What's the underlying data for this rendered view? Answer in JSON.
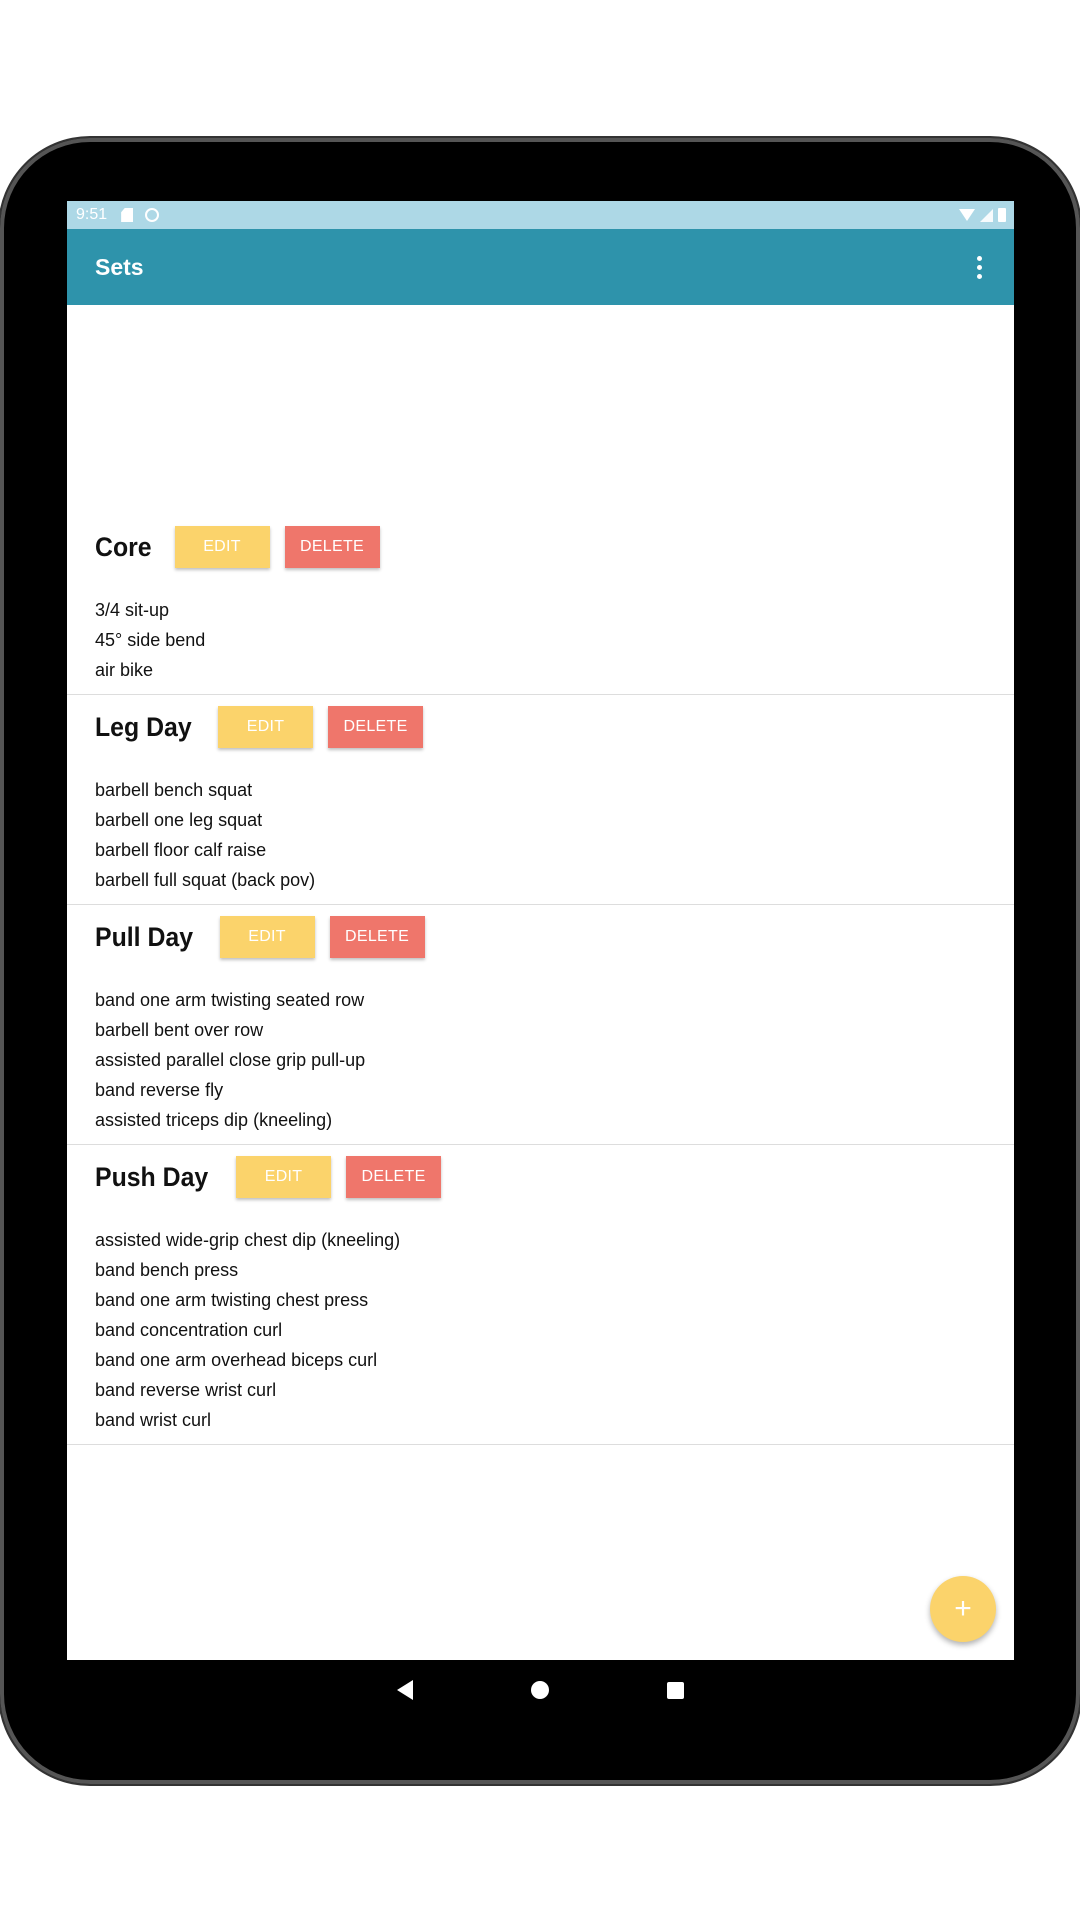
{
  "status_bar": {
    "time": "9:51"
  },
  "app_bar": {
    "title": "Sets"
  },
  "buttons": {
    "edit_label": "EDIT",
    "delete_label": "DELETE"
  },
  "sets": [
    {
      "name": "Core",
      "exercises": [
        "3/4 sit-up",
        "45° side bend",
        "air bike"
      ]
    },
    {
      "name": "Leg Day",
      "exercises": [
        "barbell bench squat",
        "barbell one leg squat",
        "barbell floor calf raise",
        "barbell full squat (back pov)"
      ]
    },
    {
      "name": "Pull Day",
      "exercises": [
        "band one arm twisting seated row",
        "barbell bent over row",
        "assisted parallel close grip pull-up",
        "band reverse fly",
        "assisted triceps dip (kneeling)"
      ]
    },
    {
      "name": "Push Day",
      "exercises": [
        "assisted wide-grip chest dip (kneeling)",
        "band bench press",
        "band one arm twisting chest press",
        "band concentration curl",
        "band one arm overhead biceps curl",
        "band reverse wrist curl",
        "band wrist curl"
      ]
    }
  ],
  "fab": {
    "icon": "plus-icon",
    "glyph": "+"
  },
  "colors": {
    "app_bar": "#2e93ab",
    "status_bar": "#add8e6",
    "edit": "#fbd36b",
    "delete": "#ef766b",
    "fab": "#fbd36b"
  }
}
